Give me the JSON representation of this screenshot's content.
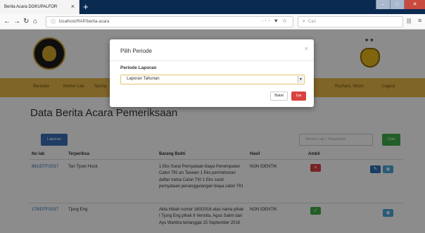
{
  "browser": {
    "tab_title": "Berita Acara  DOKUPALFOR",
    "tab_close": "×",
    "new_tab": "+",
    "url": "localhost/RAP/berita-acara",
    "page_actions": "··· ♥ ☆",
    "search_placeholder": "Cari"
  },
  "menu": {
    "items": [
      "Beranda",
      "Nomor Lab",
      "Spring"
    ],
    "user": "Rochani, Nkom",
    "logout": "Logout"
  },
  "content": {
    "title": "Data Berita Acara Pemeriksaan",
    "laporan_button": "Laporan",
    "search_placeholder": "Nomor Lab / Terperiksa",
    "cari_button": "Cari"
  },
  "table": {
    "headers": [
      "No lab",
      "Terperiksa",
      "Barang Bukti",
      "Hasil",
      "Ambil"
    ],
    "rows": [
      {
        "no_lab": "861/DTF/2017",
        "terperiksa": "Tan Tjoen Hock",
        "barang_bukti": "1 Eks Surat Pernyataan biaya Penempatan Calon TKI an Taswan 1 Eks permohonan daftar nama Calon TKI 1 Eks surat pernyataan penanggulangan biaya calon TKI",
        "hasil": "NON IDENTIK",
        "ambil_status": "×"
      },
      {
        "no_lab": "179/DTF/2017",
        "terperiksa": "Tjung Eng",
        "barang_bukti": "Akta Hibah nomor 160/2016 atas nama pihak I Tjung Eng pihak II Vennita, Agus Salim dan Ayu Wantira tertanggal 15 September 2016",
        "hasil": "NON IDENTIK",
        "ambil_status": "✓"
      }
    ]
  },
  "modal": {
    "title": "Pilih Periode",
    "close": "×",
    "label": "Periode Laporan",
    "selected": "Laporan Tahunan",
    "batal": "Batal",
    "iya": "Iya"
  },
  "colors": {
    "menubar": "#e8b84a",
    "primary": "#3a6db6",
    "success": "#3fab48",
    "danger": "#d9423e"
  }
}
